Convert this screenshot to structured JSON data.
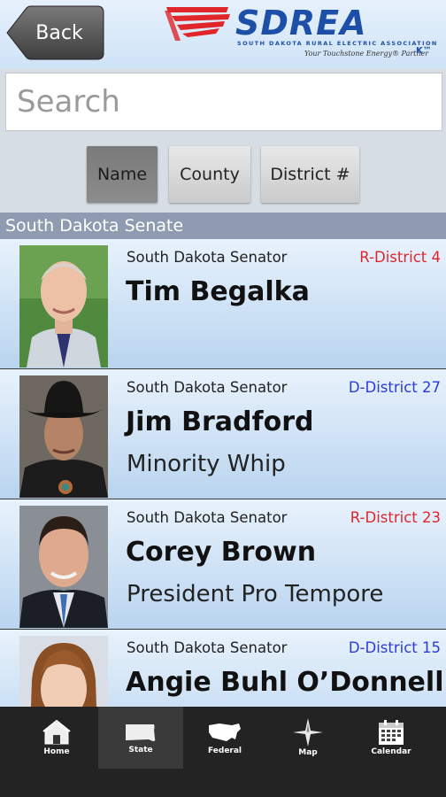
{
  "header": {
    "back_label": "Back",
    "logo_name": "SDREA",
    "logo_subtitle": "SOUTH DAKOTA RURAL ELECTRIC ASSOCIATION",
    "logo_tagline": "Your Touchstone Energy® Partner",
    "logo_mark": "K™"
  },
  "search": {
    "placeholder": "Search"
  },
  "sort": {
    "name": "Name",
    "county": "County",
    "district": "District #",
    "active": "Name"
  },
  "section_title": "South Dakota Senate",
  "legislators": [
    {
      "role": "South Dakota Senator",
      "district": "R-District 4",
      "party": "R",
      "name": "Tim Begalka",
      "title": ""
    },
    {
      "role": "South Dakota Senator",
      "district": "D-District 27",
      "party": "D",
      "name": "Jim Bradford",
      "title": "Minority Whip"
    },
    {
      "role": "South Dakota Senator",
      "district": "R-District 23",
      "party": "R",
      "name": "Corey Brown",
      "title": "President Pro Tempore"
    },
    {
      "role": "South Dakota Senator",
      "district": "D-District 15",
      "party": "D",
      "name": "Angie Buhl O’Donnell",
      "title": ""
    }
  ],
  "nav": {
    "home": "Home",
    "state": "State",
    "federal": "Federal",
    "map": "Map",
    "calendar": "Calendar",
    "active": "State"
  },
  "colors": {
    "republican": "#e0262b",
    "democrat": "#2a3bdc",
    "logo_blue": "#1e4fa8",
    "logo_red": "#e0262b"
  }
}
